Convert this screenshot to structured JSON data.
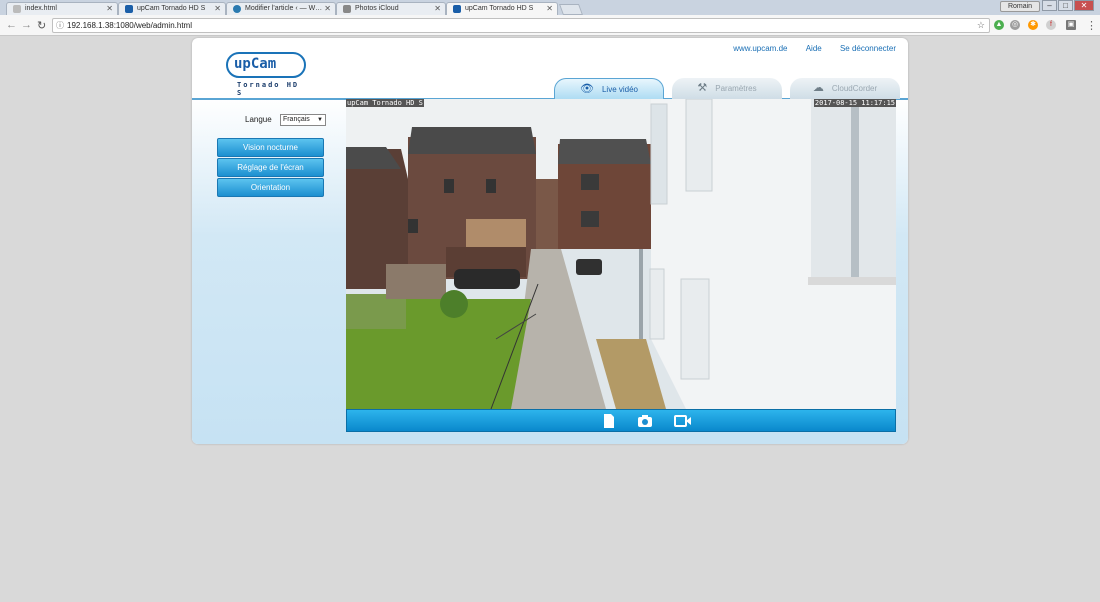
{
  "browser": {
    "tabs": [
      {
        "title": "index.html",
        "active": false
      },
      {
        "title": "upCam Tornado HD S",
        "active": false
      },
      {
        "title": "Modifier l'article ‹ — W…",
        "active": false
      },
      {
        "title": "Photos iCloud",
        "active": false
      },
      {
        "title": "upCam Tornado HD S",
        "active": true
      }
    ],
    "user_button": "Romain",
    "url": "192.168.1.38:1080/web/admin.html"
  },
  "header": {
    "logo_text": "upCam",
    "logo_sub": "Tornado HD S",
    "links": [
      "www.upcam.de",
      "Aide",
      "Se déconnecter"
    ]
  },
  "tabs": [
    {
      "label": "Live vidéo",
      "icon": "eye-icon",
      "active": true
    },
    {
      "label": "Paramètres",
      "icon": "tools-icon",
      "active": false
    },
    {
      "label": "CloudCorder",
      "icon": "cloud-recorder-icon",
      "active": false
    }
  ],
  "sidebar": {
    "language_label": "Langue",
    "language_value": "Français",
    "buttons": [
      "Vision nocturne",
      "Réglage de l'écran",
      "Orientation"
    ]
  },
  "video": {
    "osd_title": "upCam Tornado HD S",
    "osd_timestamp": "2017-08-15 11:17:15"
  },
  "controls": [
    "file-icon",
    "camera-icon",
    "video-camera-icon"
  ],
  "colors": {
    "accent": "#1c8fd0",
    "link": "#1a6fb5"
  }
}
